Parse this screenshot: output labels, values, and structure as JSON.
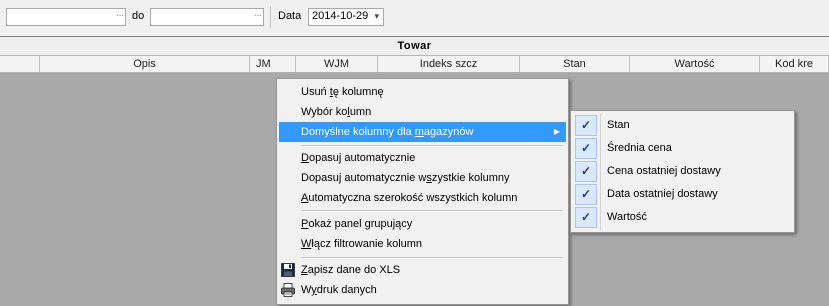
{
  "toolbar": {
    "from_value": "",
    "from_ellipsis": "···",
    "to_label": "do",
    "to_value": "",
    "to_ellipsis": "···",
    "date_label": "Data",
    "date_value": "2014-10-29",
    "date_arrow": "▾"
  },
  "grid": {
    "band_title": "Towar",
    "columns": [
      {
        "label": ""
      },
      {
        "label": "Opis"
      },
      {
        "label": "JM"
      },
      {
        "label": "WJM"
      },
      {
        "label": "Indeks szcz"
      },
      {
        "label": "Stan"
      },
      {
        "label": "Wartość"
      },
      {
        "label": "Kod kre"
      }
    ]
  },
  "context_menu": {
    "items": [
      {
        "pre": "Usuń ",
        "ul": "t",
        "post": "ę kolumnę"
      },
      {
        "pre": "Wybór ko",
        "ul": "l",
        "post": "umn"
      },
      {
        "pre": "Domyślne kolumny dla ",
        "ul": "m",
        "post": "agazynów",
        "submenu_arrow": "▶"
      },
      {
        "pre": "",
        "ul": "D",
        "post": "opasuj automatycznie"
      },
      {
        "pre": "Dopasuj automatycznie w",
        "ul": "s",
        "post": "zystkie kolumny"
      },
      {
        "pre": "",
        "ul": "A",
        "post": "utomatyczna szerokość wszystkich kolumn"
      },
      {
        "pre": "",
        "ul": "P",
        "post": "okaż panel grupujący"
      },
      {
        "pre": "",
        "ul": "W",
        "post": "łącz filtrowanie kolumn"
      },
      {
        "pre": "",
        "ul": "Z",
        "post": "apisz dane do XLS",
        "icon": "floppy-disk-icon"
      },
      {
        "pre": "W",
        "ul": "y",
        "post": "druk danych",
        "icon": "printer-icon"
      }
    ]
  },
  "submenu": {
    "check_glyph": "✓",
    "items": [
      {
        "label": "Stan",
        "checked": true
      },
      {
        "label": "Średnia cena",
        "checked": true
      },
      {
        "label": "Cena ostatniej dostawy",
        "checked": true
      },
      {
        "label": "Data ostatniej dostawy",
        "checked": true
      },
      {
        "label": "Wartość",
        "checked": true
      }
    ]
  },
  "colors": {
    "highlight": "#3399ff",
    "grid_background": "#a9a9a9",
    "menu_background": "#f1f1f1"
  }
}
